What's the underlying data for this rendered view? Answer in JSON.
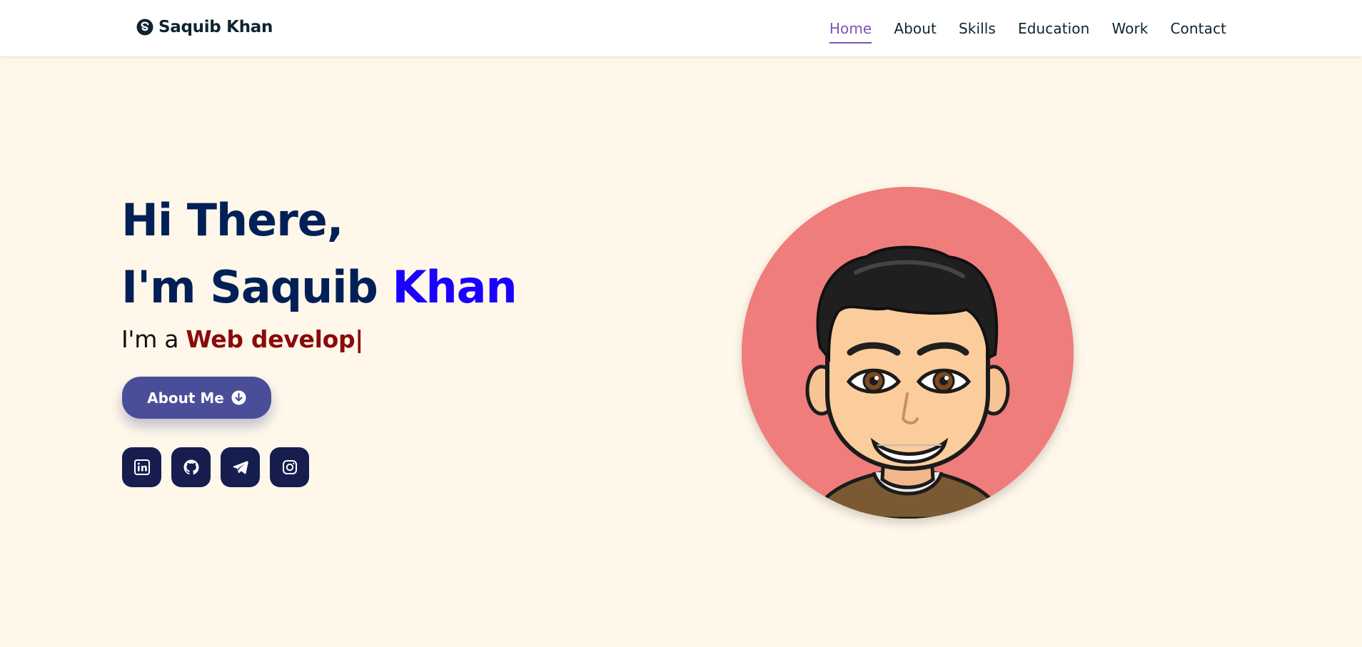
{
  "header": {
    "logo_text": "Saquib Khan",
    "logo_icon": "skype-s-icon",
    "nav": [
      {
        "label": "Home",
        "active": true
      },
      {
        "label": "About",
        "active": false
      },
      {
        "label": "Skills",
        "active": false
      },
      {
        "label": "Education",
        "active": false
      },
      {
        "label": "Work",
        "active": false
      },
      {
        "label": "Contact",
        "active": false
      }
    ]
  },
  "hero": {
    "greeting": "Hi There,",
    "intro_prefix": "I'm Saquib ",
    "intro_accent": "Khan",
    "role_prefix": "I'm a ",
    "role_typed": "Web develop",
    "cursor": "|",
    "button_label": "About Me",
    "button_icon": "arrow-circle-down-icon",
    "socials": [
      "linkedin-icon",
      "github-icon",
      "telegram-icon",
      "instagram-icon"
    ]
  },
  "colors": {
    "background": "#fff8ea",
    "nav_active": "#7d52b8",
    "heading": "#002057",
    "accent": "#1a00ff",
    "typed": "#8b0a0a",
    "button": "#4a4e99",
    "social_bg": "#161e4f",
    "avatar_bg": "#ef7d7b"
  }
}
